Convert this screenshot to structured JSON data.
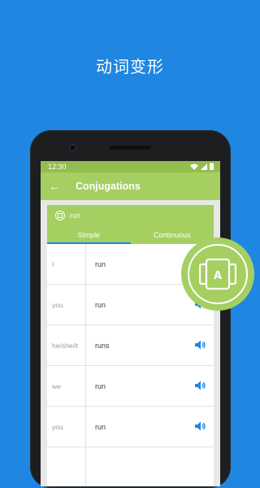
{
  "headline": "动词变形",
  "status": {
    "time": "12:30"
  },
  "appbar": {
    "back_glyph": "←",
    "title": "Conjugations"
  },
  "card": {
    "word": "run",
    "tabs": [
      {
        "label": "Simple",
        "active": true
      },
      {
        "label": "Continuous",
        "active": false
      }
    ],
    "rows": [
      {
        "pronoun": "I",
        "form": "run"
      },
      {
        "pronoun": "you",
        "form": "run"
      },
      {
        "pronoun": "he/she/it",
        "form": "runs"
      },
      {
        "pronoun": "we",
        "form": "run"
      },
      {
        "pronoun": "you",
        "form": "run"
      },
      {
        "pronoun": "",
        "form": ""
      }
    ]
  },
  "badge": {
    "letter": "A",
    "icon": "flashcard-app-icon"
  },
  "colors": {
    "background": "#1f86e2",
    "appbar": "#a5cf61",
    "statusbar": "#93bd4f",
    "speaker_icon": "#1f86e2"
  }
}
